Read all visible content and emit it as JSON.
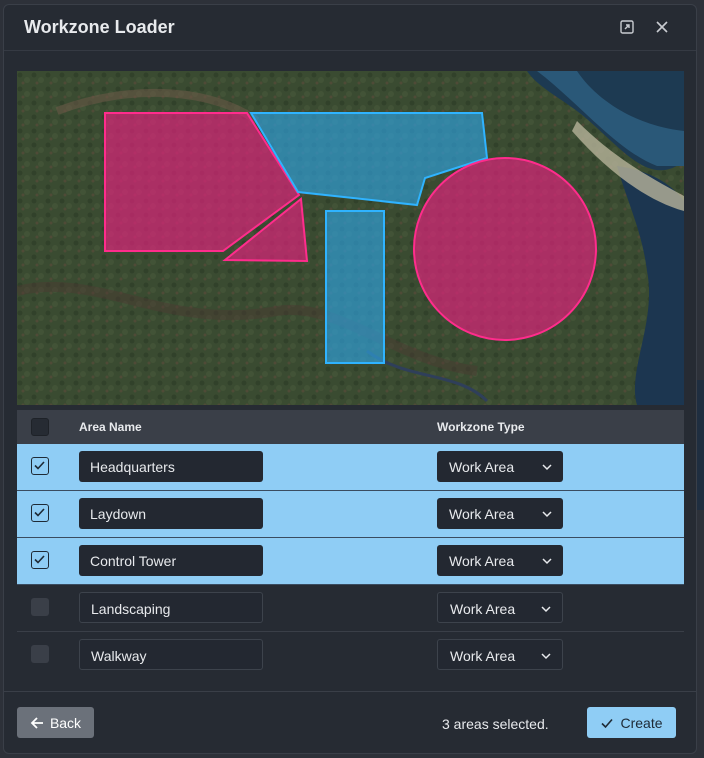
{
  "dialog": {
    "title": "Workzone Loader",
    "icons": {
      "expand": "expand-icon",
      "close": "close-icon"
    }
  },
  "map": {
    "zone_colors": {
      "magenta": "#e8207f",
      "blue": "#2ea3e0"
    }
  },
  "table": {
    "columns": {
      "area_name": "Area Name",
      "workzone_type": "Workzone Type"
    },
    "rows": [
      {
        "name": "Headquarters",
        "type": "Work Area",
        "checked": true
      },
      {
        "name": "Laydown",
        "type": "Work Area",
        "checked": true
      },
      {
        "name": "Control Tower",
        "type": "Work Area",
        "checked": true
      },
      {
        "name": "Landscaping",
        "type": "Work Area",
        "checked": false
      },
      {
        "name": "Walkway",
        "type": "Work Area",
        "checked": false
      }
    ]
  },
  "footer": {
    "back_label": "Back",
    "status": "3 areas selected.",
    "create_label": "Create"
  },
  "colors": {
    "accent": "#8fcdf5",
    "dialog_bg": "#262b33",
    "back_button": "#6b717a"
  }
}
